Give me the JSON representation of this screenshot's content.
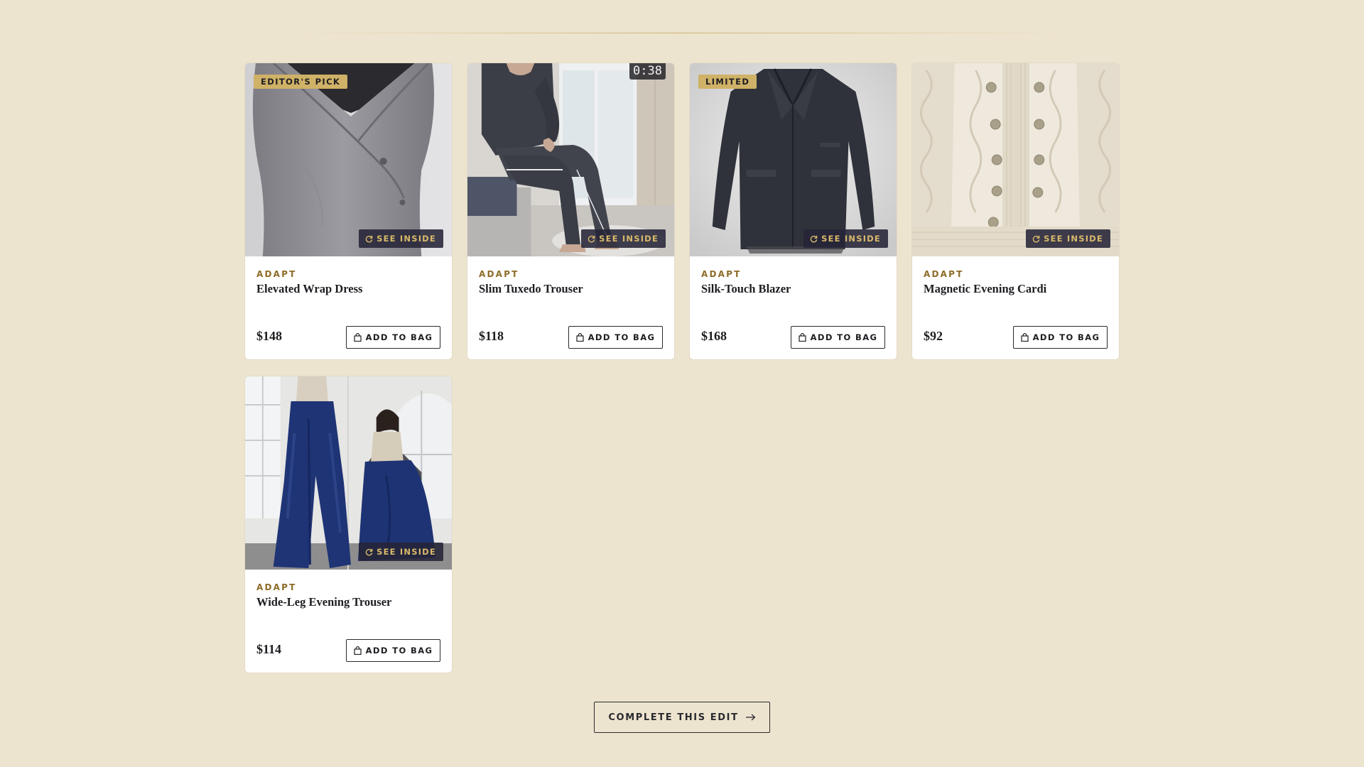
{
  "products": [
    {
      "badge": "EDITOR'S PICK",
      "timer": "",
      "see_inside_label": "SEE INSIDE",
      "brand": "ADAPT",
      "name": "Elevated Wrap Dress",
      "price": "$148",
      "add_label": "ADD TO BAG",
      "image": "wrap-dress-on-mannequin"
    },
    {
      "badge": "",
      "timer": "0:38",
      "see_inside_label": "SEE INSIDE",
      "brand": "ADAPT",
      "name": "Slim Tuxedo Trouser",
      "price": "$118",
      "add_label": "ADD TO BAG",
      "image": "seated-model-tuxedo-trouser"
    },
    {
      "badge": "LIMITED",
      "timer": "",
      "see_inside_label": "SEE INSIDE",
      "brand": "ADAPT",
      "name": "Silk-Touch Blazer",
      "price": "$168",
      "add_label": "ADD TO BAG",
      "image": "dark-coat-flat-lay"
    },
    {
      "badge": "",
      "timer": "",
      "see_inside_label": "SEE INSIDE",
      "brand": "ADAPT",
      "name": "Magnetic Evening Cardi",
      "price": "$92",
      "add_label": "ADD TO BAG",
      "image": "cream-cable-knit-cardigan"
    },
    {
      "badge": "",
      "timer": "",
      "see_inside_label": "SEE INSIDE",
      "brand": "ADAPT",
      "name": "Wide-Leg Evening Trouser",
      "price": "$114",
      "add_label": "ADD TO BAG",
      "image": "navy-wide-leg-trousers-models"
    }
  ],
  "cta": {
    "label": "COMPLETE THIS EDIT",
    "icon": "arrow-right-icon"
  },
  "icons": {
    "see_inside": "rotate-icon",
    "add": "bag-icon"
  },
  "colors": {
    "page_bg": "#ede4cf",
    "accent_gold": "#cfb167",
    "brand_text": "#8d6c28",
    "overlay": "#262438",
    "ink": "#1d1d22"
  }
}
